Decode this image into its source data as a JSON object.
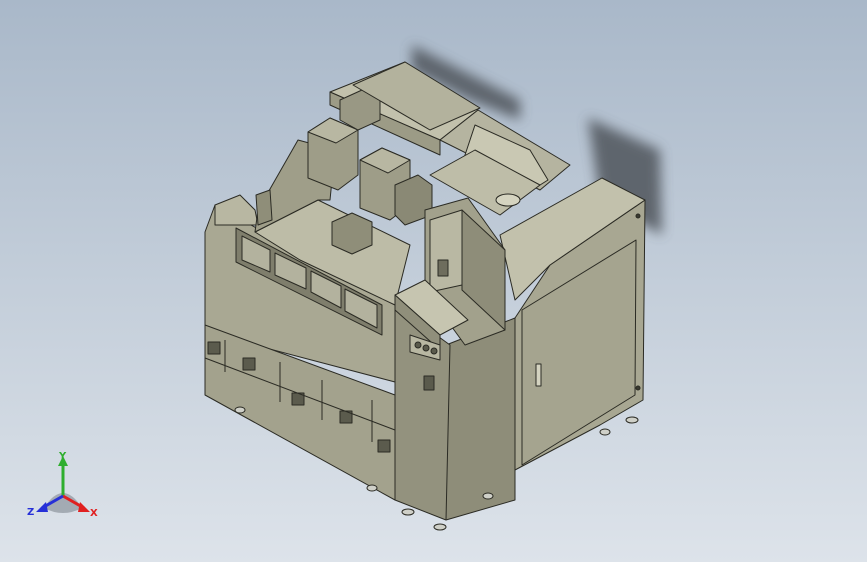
{
  "viewport": {
    "background_top": "#a9b8c9",
    "background_bottom": "#dde3ea"
  },
  "model": {
    "body_color": "#a9a893",
    "dark_face_color": "#8e8d79",
    "light_face_color": "#c2c1ac",
    "edge_color": "#2b2b24",
    "shadow_color": "#5a5f66"
  },
  "triad": {
    "y_label": "Y",
    "z_label": "Z",
    "x_label": "X",
    "x_color": "#e02020",
    "y_color": "#2eae2e",
    "z_color": "#2630d8"
  }
}
